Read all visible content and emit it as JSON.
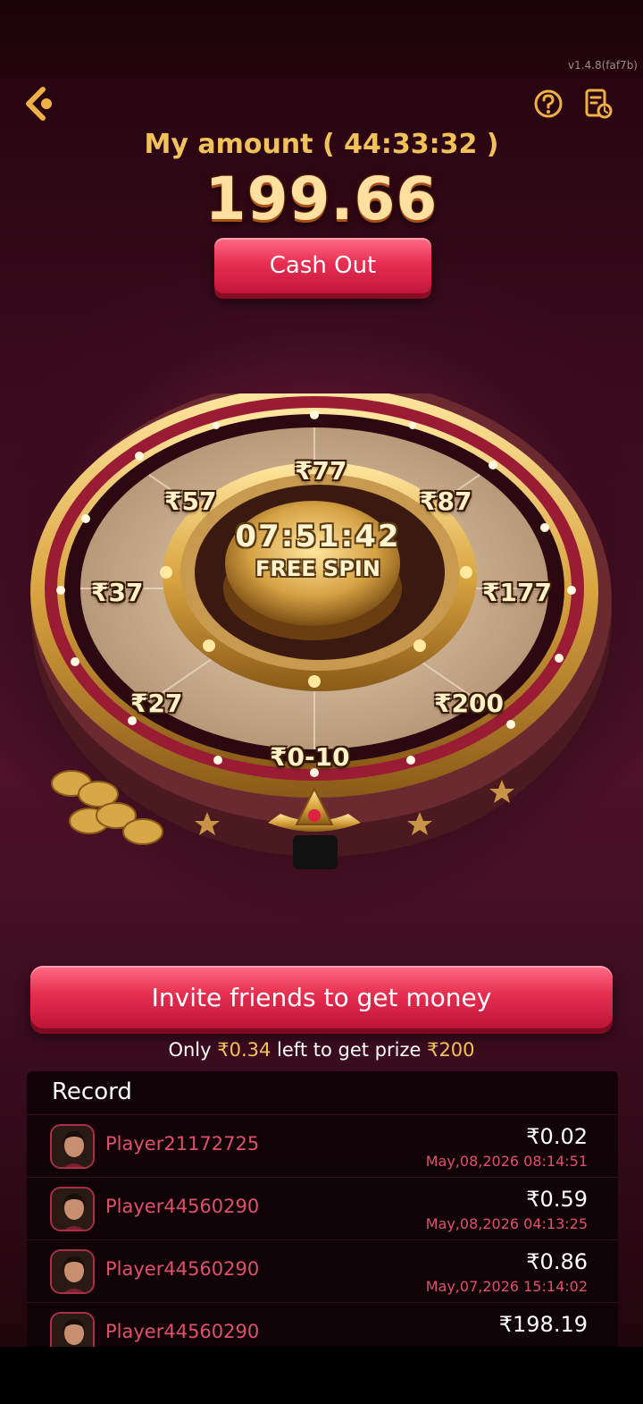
{
  "version": "v1.4.8(faf7b)",
  "header": {
    "amount_title": "My amount ( 44:33:32 )",
    "amount_value": "199.66",
    "cashout_label": "Cash Out"
  },
  "wheel": {
    "timer": "07:51:42",
    "center_label": "FREE SPIN",
    "prizes": [
      "₹77",
      "₹87",
      "₹177",
      "₹200",
      "₹0-10",
      "₹27",
      "₹37",
      "₹57"
    ]
  },
  "invite": {
    "button_label": "Invite friends to get money",
    "progress_prefix": "Only ",
    "progress_left": "₹0.34",
    "progress_middle": " left to get prize ",
    "progress_prize": "₹200"
  },
  "records": {
    "title": "Record",
    "rows": [
      {
        "player": "Player21172725",
        "amount": "₹0.02",
        "date": "May,08,2026 08:14:51"
      },
      {
        "player": "Player44560290",
        "amount": "₹0.59",
        "date": "May,08,2026 04:13:25"
      },
      {
        "player": "Player44560290",
        "amount": "₹0.86",
        "date": "May,07,2026 15:14:02"
      },
      {
        "player": "Player44560290",
        "amount": "₹198.19",
        "date": ""
      }
    ]
  },
  "colors": {
    "gold": "#f2c25a",
    "red_button": "#e82f52",
    "pink_text": "#e0506a",
    "background": "#4e1128"
  },
  "icons": [
    "back-arrow-icon",
    "help-icon",
    "records-clock-icon"
  ]
}
